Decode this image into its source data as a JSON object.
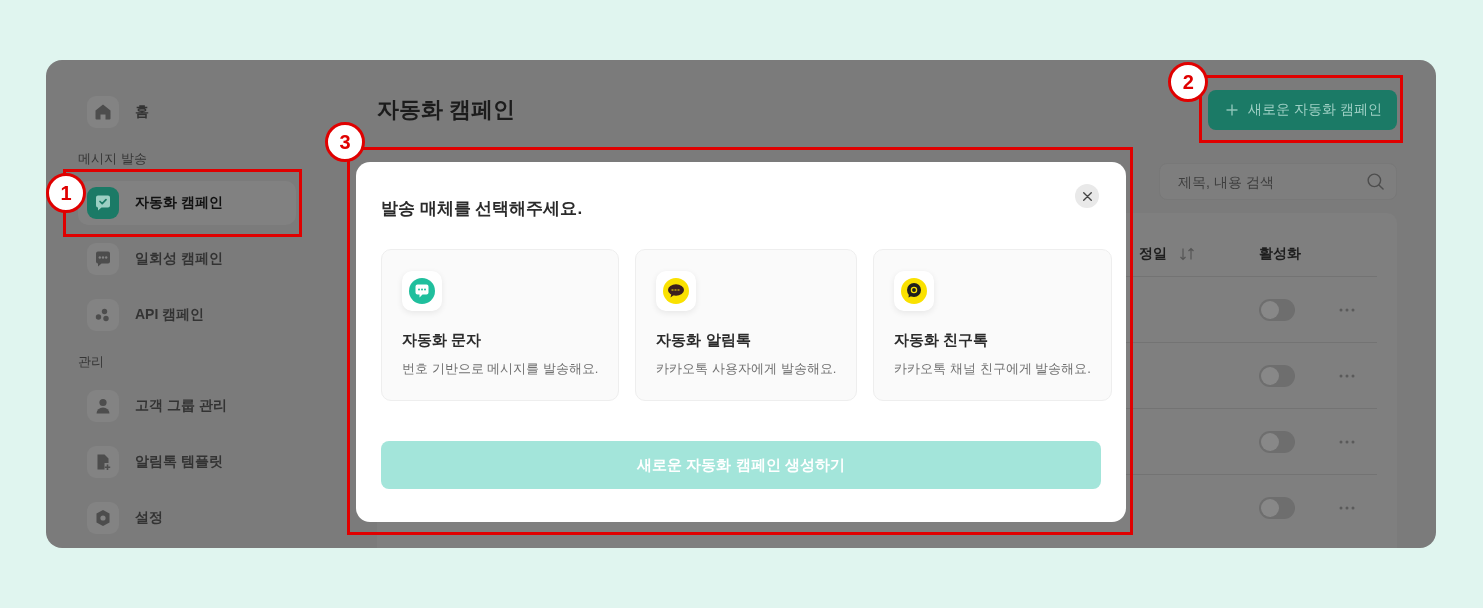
{
  "sidebar": {
    "home": {
      "label": "홈",
      "selected": false
    },
    "groups": [
      {
        "title": "메시지 발송",
        "items": [
          {
            "label": "자동화 캠페인",
            "selected": true,
            "callout": "1"
          },
          {
            "label": "일회성 캠페인",
            "selected": false
          },
          {
            "label": "API 캠페인",
            "selected": false
          }
        ]
      },
      {
        "title": "관리",
        "items": [
          {
            "label": "고객 그룹 관리",
            "selected": false
          },
          {
            "label": "알림톡 템플릿",
            "selected": false
          },
          {
            "label": "설정",
            "selected": false
          }
        ]
      }
    ]
  },
  "page": {
    "title": "자동화 캠페인",
    "new_button": {
      "label": "새로운 자동화 캠페인",
      "callout": "2"
    },
    "search": {
      "placeholder": "제목, 내용 검색"
    }
  },
  "table": {
    "columns": [
      {
        "label": "정일",
        "sortable": true
      },
      {
        "label": "활성화",
        "sortable": false
      }
    ],
    "rows": [
      {
        "active": false
      },
      {
        "active": false
      },
      {
        "active": false
      },
      {
        "active": false
      }
    ]
  },
  "modal": {
    "title": "발송 매체를 선택해주세요.",
    "callout": "3",
    "options": [
      {
        "kind": "sms",
        "title": "자동화 문자",
        "description": "번호 기반으로 메시지를 발송해요.",
        "selected": false
      },
      {
        "kind": "alimtalk",
        "title": "자동화 알림톡",
        "description": "카카오톡 사용자에게 발송해요.",
        "selected": false
      },
      {
        "kind": "friendtalk",
        "title": "자동화 친구톡",
        "description": "카카오톡 채널 친구에게 발송해요.",
        "selected": false
      }
    ],
    "submit": {
      "label": "새로운 자동화 캠페인 생성하기",
      "disabled": true
    }
  }
}
